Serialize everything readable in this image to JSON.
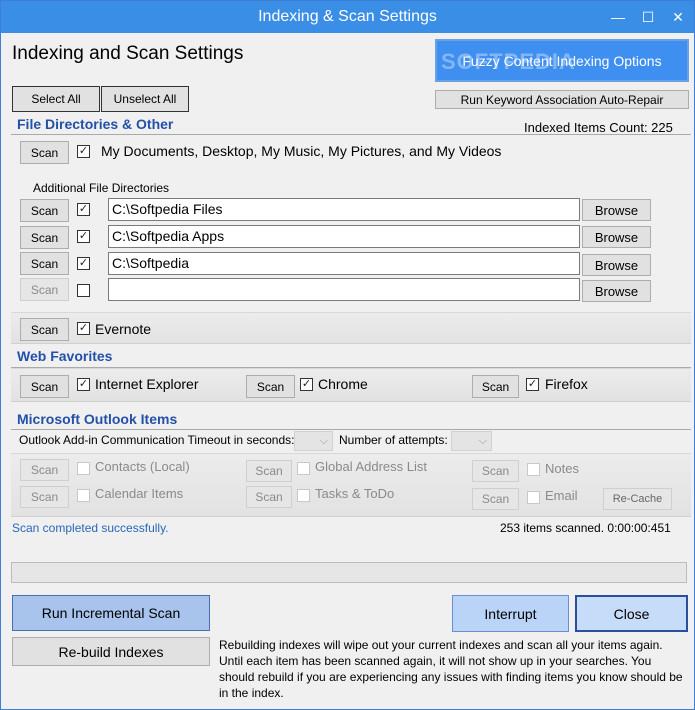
{
  "window": {
    "title": "Indexing & Scan Settings",
    "minimize_glyph": "—",
    "maximize_glyph": "☐",
    "close_glyph": "✕"
  },
  "header": {
    "heading": "Indexing and Scan Settings",
    "fuzzy_button": "Fuzzy Content Indexing Options",
    "watermark": "SOFTPEDIA",
    "auto_repair_button": "Run Keyword Association Auto-Repair",
    "select_all": "Select All",
    "unselect_all": "Unselect All"
  },
  "file_section": {
    "title": "File Directories & Other",
    "indexed_count": "Indexed Items Count: 225",
    "main_label": "My Documents, Desktop, My Music, My Pictures, and My Videos",
    "additional_label": "Additional File Directories",
    "scan_label": "Scan",
    "browse_label": "Browse",
    "dirs": [
      {
        "path": "C:\\Softpedia Files",
        "checked": true
      },
      {
        "path": "C:\\Softpedia Apps",
        "checked": true
      },
      {
        "path": "C:\\Softpedia",
        "checked": true
      },
      {
        "path": "",
        "checked": false
      }
    ],
    "evernote": "Evernote"
  },
  "web_section": {
    "title": "Web Favorites",
    "ie": "Internet Explorer",
    "chrome": "Chrome",
    "firefox": "Firefox"
  },
  "outlook_section": {
    "title": "Microsoft Outlook Items",
    "timeout_label": "Outlook Add-in Communication Timeout in seconds:",
    "attempts_label": "Number of attempts:",
    "contacts": "Contacts (Local)",
    "global_address": "Global Address List",
    "notes": "Notes",
    "calendar": "Calendar Items",
    "tasks": "Tasks & ToDo",
    "email": "Email",
    "recache": "Re-Cache"
  },
  "status": {
    "message": "Scan completed successfully.",
    "summary": "253 items scanned. 0:00:00:451",
    "progress": 0
  },
  "footer": {
    "run_incremental": "Run Incremental Scan",
    "rebuild": "Re-build Indexes",
    "interrupt": "Interrupt",
    "close": "Close",
    "note": "Rebuilding indexes will wipe out your current indexes and scan all your items again. Until each item has been scanned again, it will not show up in your searches. You should rebuild if you are experiencing any issues with finding items you know should be in the index."
  }
}
